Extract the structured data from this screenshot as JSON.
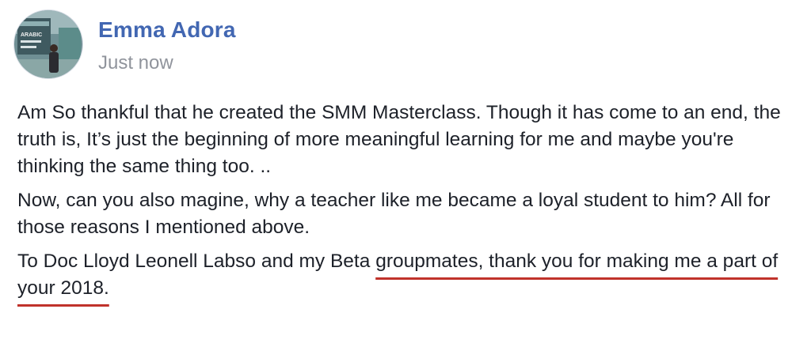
{
  "post": {
    "author": "Emma Adora",
    "timestamp": "Just now",
    "avatar_sign_text": "ARABIC",
    "paragraphs": [
      {
        "text": "Am So thankful that he created the SMM Masterclass. Though it has come to an end, the truth is, It’s just the beginning of more meaningful learning for me and maybe you're thinking the same thing too. .."
      },
      {
        "text": "Now, can you also magine, why a teacher like me became a loyal student to him? All for those reasons I mentioned above."
      },
      {
        "lead": "To Doc Lloyd Leonell Labso and my Beta ",
        "highlight": "groupmates, thank you for making me a part of your 2018."
      }
    ],
    "colors": {
      "author": "#4267b2",
      "timestamp": "#90949c",
      "text": "#1d2129",
      "underline": "#c0322b"
    }
  }
}
